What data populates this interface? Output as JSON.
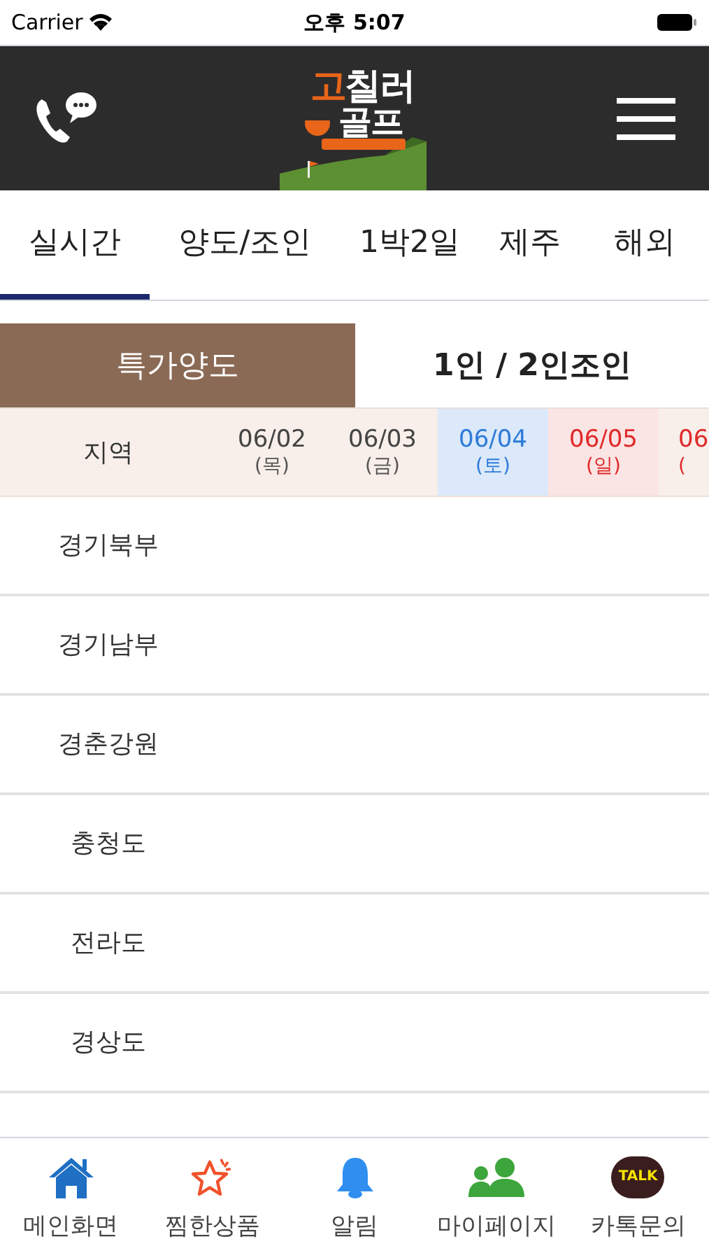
{
  "status_bar": {
    "carrier": "Carrier",
    "time": "오후 5:07"
  },
  "header": {
    "logo": {
      "line1_accent": "고",
      "line1": "칠러",
      "line2": "골프"
    }
  },
  "tabs": [
    {
      "label": "실시간",
      "selected": true
    },
    {
      "label": "양도/조인",
      "selected": false
    },
    {
      "label": "1박2일",
      "selected": false
    },
    {
      "label": "제주",
      "selected": false
    },
    {
      "label": "해외",
      "selected": false
    }
  ],
  "segments": [
    {
      "label": "특가양도",
      "selected": true
    },
    {
      "label": "1인 / 2인조인",
      "selected": false
    }
  ],
  "table": {
    "region_header": "지역",
    "dates": [
      {
        "date": "06/02",
        "day": "(목)",
        "kind": "weekday"
      },
      {
        "date": "06/03",
        "day": "(금)",
        "kind": "weekday"
      },
      {
        "date": "06/04",
        "day": "(토)",
        "kind": "saturday"
      },
      {
        "date": "06/05",
        "day": "(일)",
        "kind": "sunday"
      },
      {
        "date": "06",
        "day": "(",
        "kind": "weekday_red"
      }
    ],
    "rows": [
      "경기북부",
      "경기남부",
      "경춘강원",
      "충청도",
      "전라도",
      "경상도"
    ]
  },
  "bottom_nav": [
    {
      "label": "메인화면",
      "kind": "home"
    },
    {
      "label": "찜한상품",
      "kind": "star"
    },
    {
      "label": "알림",
      "kind": "bell"
    },
    {
      "label": "마이페이지",
      "kind": "people"
    },
    {
      "label": "카톡문의",
      "kind": "talk",
      "icon_text": "TALK"
    }
  ]
}
